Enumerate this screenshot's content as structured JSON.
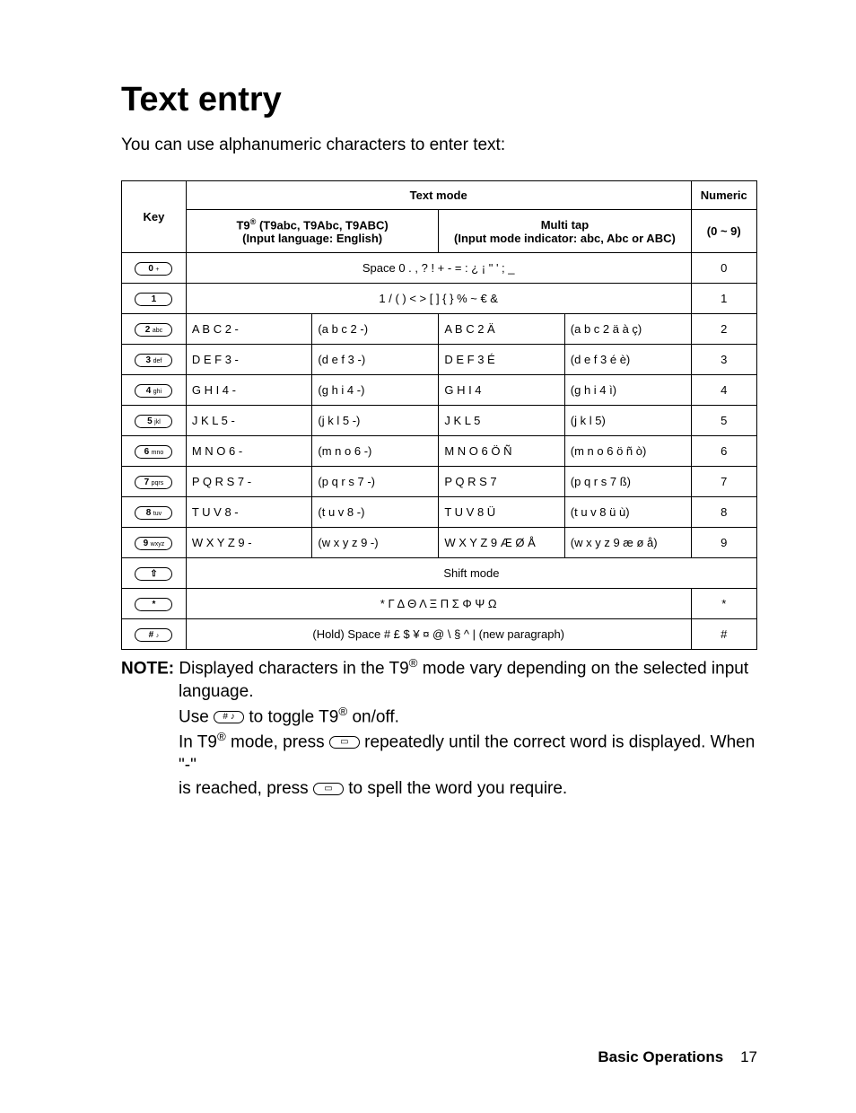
{
  "title": "Text entry",
  "intro": "You can use alphanumeric characters to enter text:",
  "headers": {
    "key": "Key",
    "textmode": "Text mode",
    "numeric": "Numeric",
    "t9_line1": "T9",
    "t9_line1b": " (T9abc, T9Abc, T9ABC)",
    "t9_line2": "(Input language: English)",
    "multi_line1": "Multi tap",
    "multi_line2": "(Input mode indicator: abc, Abc or ABC)",
    "numeric_range": "(0 ~ 9)"
  },
  "rows": [
    {
      "key": {
        "big": "0",
        "small": "+"
      },
      "span": "Space 0 . , ? !  + - = : ¿ ¡  \" ' ; _",
      "num": "0"
    },
    {
      "key": {
        "big": "1",
        "small": ""
      },
      "span": "1 / (  ) < > [ ] { } % ~ € &",
      "num": "1"
    },
    {
      "key": {
        "big": "2",
        "small": "abc"
      },
      "t9u": "A B C 2 -",
      "t9l": "(a b c 2 -)",
      "mtu": "A B C 2 Ä",
      "mtl": "(a b c 2 ä à ç)",
      "num": "2"
    },
    {
      "key": {
        "big": "3",
        "small": "def"
      },
      "t9u": "D E F 3 -",
      "t9l": "(d e f 3 -)",
      "mtu": "D E F 3 É",
      "mtl": "(d e f 3 é è)",
      "num": "3"
    },
    {
      "key": {
        "big": "4",
        "small": "ghi"
      },
      "t9u": "G H I 4 -",
      "t9l": "(g h i 4 -)",
      "mtu": "G H I 4",
      "mtl": "(g h i 4 ì)",
      "num": "4"
    },
    {
      "key": {
        "big": "5",
        "small": "jkl"
      },
      "t9u": "J K L 5 -",
      "t9l": "(j k l 5 -)",
      "mtu": "J K L 5",
      "mtl": "(j k l 5)",
      "num": "5"
    },
    {
      "key": {
        "big": "6",
        "small": "mno"
      },
      "t9u": "M N O 6 -",
      "t9l": "(m n o 6 -)",
      "mtu": "M N O 6 Ö Ñ",
      "mtl": "(m n o 6 ö ñ ò)",
      "num": "6"
    },
    {
      "key": {
        "big": "7",
        "small": "pqrs"
      },
      "t9u": "P Q R S 7 -",
      "t9l": "(p q r s 7 -)",
      "mtu": "P Q R S 7",
      "mtl": "(p q r s 7 ß)",
      "num": "7"
    },
    {
      "key": {
        "big": "8",
        "small": "tuv"
      },
      "t9u": "T U V 8 -",
      "t9l": "(t u v 8 -)",
      "mtu": "T U V 8 Ü",
      "mtl": "(t u v 8 ü ù)",
      "num": "8"
    },
    {
      "key": {
        "big": "9",
        "small": "wxyz"
      },
      "t9u": "W X Y Z 9 -",
      "t9l": "(w x y z 9 -)",
      "mtu": "W X Y Z 9 Æ Ø Å",
      "mtl": "(w x y z 9 æ ø å)",
      "num": "9"
    },
    {
      "key": {
        "big": "⇧",
        "small": ""
      },
      "full": "Shift mode"
    },
    {
      "key": {
        "big": "*",
        "small": ""
      },
      "span": "* Γ Δ Θ Λ Ξ Π Σ Φ Ψ Ω",
      "num": "*"
    },
    {
      "key": {
        "big": "#",
        "small": "♪"
      },
      "span": "(Hold) Space # £ $ ¥ ¤ @ \\ § ^ | (new paragraph)",
      "num": "#"
    }
  ],
  "note": {
    "label": "NOTE:",
    "l1a": "Displayed characters in the T9",
    "l1b": " mode vary depending on the selected input",
    "l2": "language.",
    "l3a": "Use ",
    "l3b": " to toggle T9",
    "l3c": " on/off.",
    "l4a": "In T9",
    "l4b": " mode, press ",
    "l4c": " repeatedly until the correct word is displayed. When \"-\"",
    "l5a": "is reached, press ",
    "l5b": " to spell the word you require."
  },
  "inline_keys": {
    "hash": "# ♪",
    "box": "▭"
  },
  "footer": {
    "section": "Basic Operations",
    "page": "17"
  }
}
